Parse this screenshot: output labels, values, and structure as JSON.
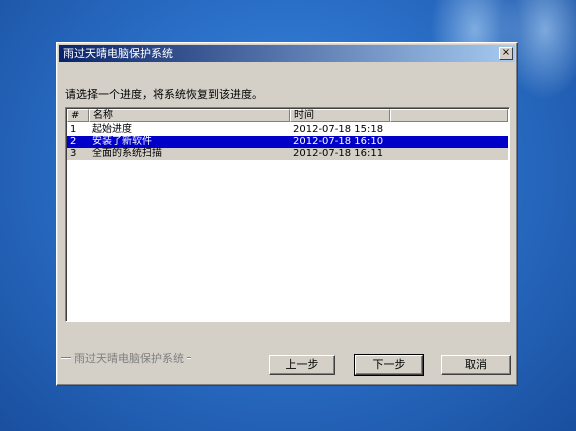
{
  "window": {
    "title": "雨过天晴电脑保护系统",
    "close_glyph": "×"
  },
  "prompt": "请选择一个进度，将系统恢复到该进度。",
  "list": {
    "columns": [
      "#",
      "名称",
      "时间",
      ""
    ],
    "rows": [
      {
        "num": "1",
        "name": "起始进度",
        "time": "2012-07-18 15:18",
        "state": "normal"
      },
      {
        "num": "2",
        "name": "安装了新软件",
        "time": "2012-07-18 16:10",
        "state": "selected"
      },
      {
        "num": "3",
        "name": "全面的系统扫描",
        "time": "2012-07-18 16:11",
        "state": "alt"
      }
    ]
  },
  "footer": {
    "brand": "雨过天晴电脑保护系统"
  },
  "buttons": {
    "prev": "上一步",
    "next": "下一步",
    "cancel": "取消"
  },
  "colors": {
    "selection": "#0000c8",
    "title_start": "#0a246a",
    "title_end": "#a6caf0",
    "desktop": "#2a6fc8"
  }
}
